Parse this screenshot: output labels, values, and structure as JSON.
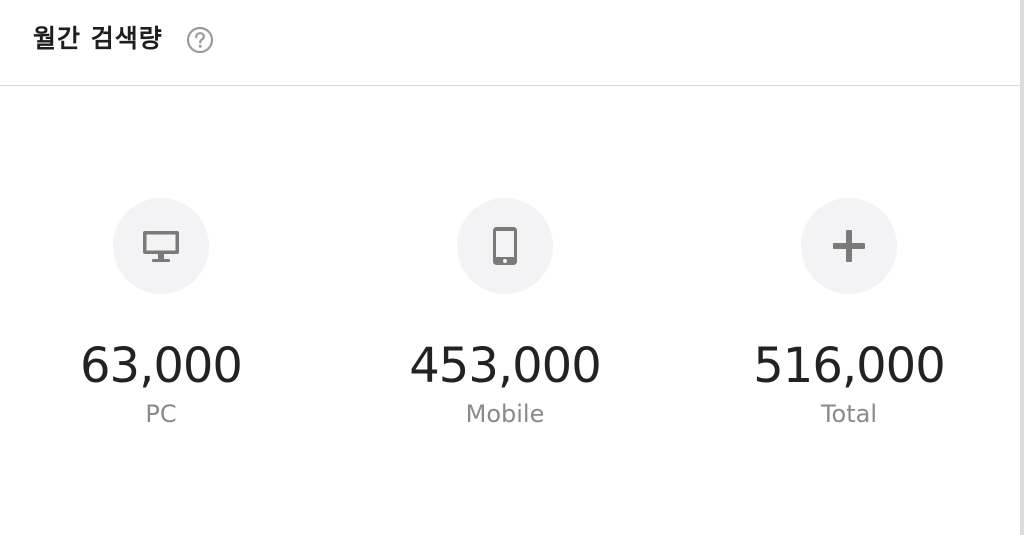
{
  "header": {
    "title": "월간 검색량",
    "help_icon": "question-circle-icon"
  },
  "stats": [
    {
      "icon": "monitor-icon",
      "value": "63,000",
      "label": "PC"
    },
    {
      "icon": "smartphone-icon",
      "value": "453,000",
      "label": "Mobile"
    },
    {
      "icon": "plus-icon",
      "value": "516,000",
      "label": "Total"
    }
  ],
  "colors": {
    "icon": "#7a7a7a",
    "circle_bg": "#f3f3f5",
    "value_text": "#222222",
    "label_text": "#8a8a8a"
  }
}
